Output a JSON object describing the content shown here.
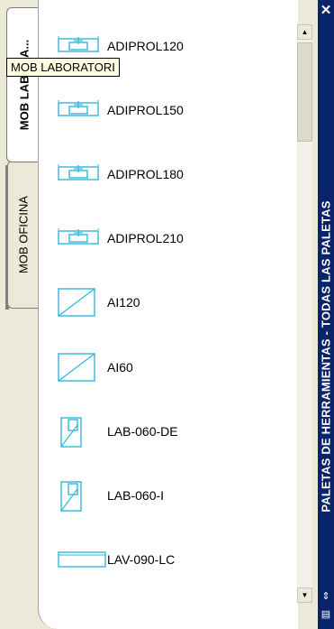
{
  "tabs": [
    {
      "label": "MOB LABORA..."
    },
    {
      "label": "MOB OFICINA"
    }
  ],
  "tooltip": "MOB LABORATORI",
  "items": [
    {
      "label": "ADIPROL120",
      "icon": "adiprol-icon"
    },
    {
      "label": "ADIPROL150",
      "icon": "adiprol-icon"
    },
    {
      "label": "ADIPROL180",
      "icon": "adiprol-icon"
    },
    {
      "label": "ADIPROL210",
      "icon": "adiprol-icon"
    },
    {
      "label": "AI120",
      "icon": "ai-icon"
    },
    {
      "label": "AI60",
      "icon": "ai-icon"
    },
    {
      "label": "LAB-060-DE",
      "icon": "lab-icon"
    },
    {
      "label": "LAB-060-I",
      "icon": "lab-icon"
    },
    {
      "label": "LAV-090-LC",
      "icon": "lav-icon"
    }
  ],
  "titlebar": {
    "title": "PALETAS DE HERRAMIENTAS - TODAS LAS PALETAS",
    "close": "✕"
  },
  "colors": {
    "icon": "#2fb8d8",
    "titlebar": "#0a246a"
  }
}
